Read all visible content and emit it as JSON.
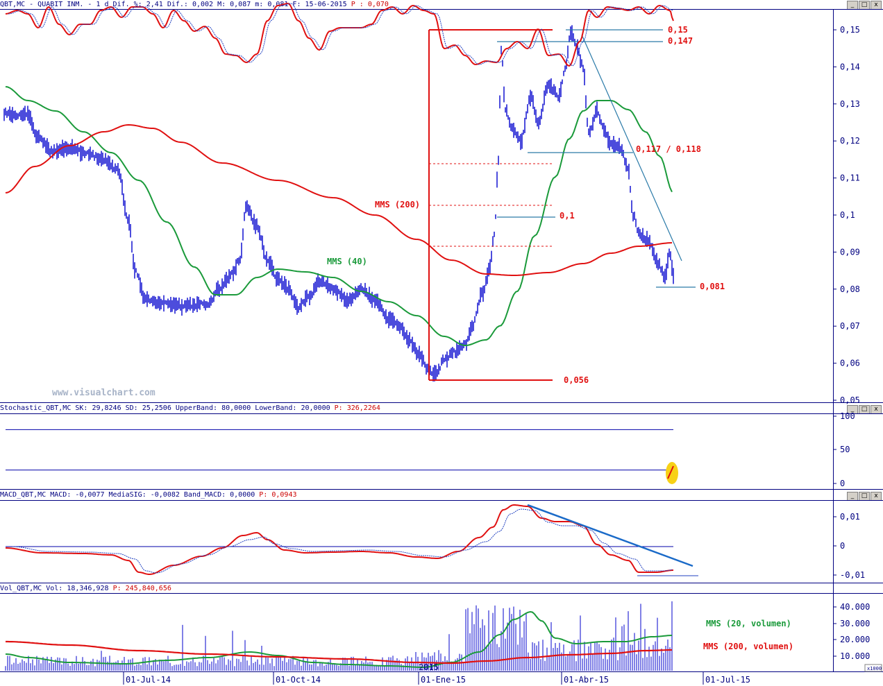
{
  "chart_data": [
    {
      "type": "line",
      "title": "QBT,MC - QUABIT INM. - 1 d Dif. %: 2,41 Dif.: 0,002 M: 0,087 m: 0,081 F: 15-06-2015",
      "title_p": "P : 0,070",
      "watermark": "www.visualchart.com",
      "ylim": [
        0.05,
        0.15
      ],
      "y_ticks": [
        "0,15",
        "0,14",
        "0,13",
        "0,12",
        "0,11",
        "0,1",
        "0,09",
        "0,08",
        "0,07",
        "0,06",
        "0,05"
      ],
      "series": [
        {
          "name": "MMS (40)",
          "color": "#1a9a3a"
        },
        {
          "name": "MMS (200)",
          "color": "#e01010"
        }
      ],
      "annotations": [
        "0,15",
        "0,147",
        "0,117 / 0,118",
        "0,1",
        "0,081",
        "0,056"
      ]
    },
    {
      "type": "line",
      "title": "Stochastic_QBT,MC SK: 29,8246 SD: 25,2506 UpperBand: 80,0000 LowerBand: 20,0000",
      "title_p": "P: 326,2264",
      "ylim": [
        0,
        100
      ],
      "y_ticks": [
        "100",
        "50",
        "0"
      ],
      "bands": [
        80,
        20
      ]
    },
    {
      "type": "line",
      "title": "MACD_QBT,MC MACD: -0,0077 MediaSIG: -0,0082 Band_MACD: 0,0000",
      "title_p": "P: 0,0943",
      "ylim": [
        -0.01,
        0.01
      ],
      "y_ticks": [
        "0,01",
        "0",
        "-0,01"
      ]
    },
    {
      "type": "bar",
      "title": "Vol_QBT,MC Vol: 18,346,928",
      "title_p": "P: 245,840,656",
      "ylim": [
        0,
        50000
      ],
      "y_ticks": [
        "40.000",
        "30.000",
        "20.000",
        "10.000"
      ],
      "y_unit": "x1000",
      "series": [
        {
          "name": "MMS (20, volumen)",
          "color": "#1a9a3a"
        },
        {
          "name": "MMS (200, volumen)",
          "color": "#e01010"
        }
      ]
    }
  ],
  "x_ticks": [
    "01-Jul-14",
    "01-Oct-14",
    "01-Ene-15",
    "01-Abr-15",
    "01-Jul-15"
  ],
  "year_label": "2015",
  "window_buttons": [
    "_",
    "□",
    "x"
  ],
  "colors": {
    "price": "#0000cc",
    "mms40": "#1a9a3a",
    "mms200": "#e01010",
    "axis": "#000080",
    "signal": "#0000cc"
  }
}
